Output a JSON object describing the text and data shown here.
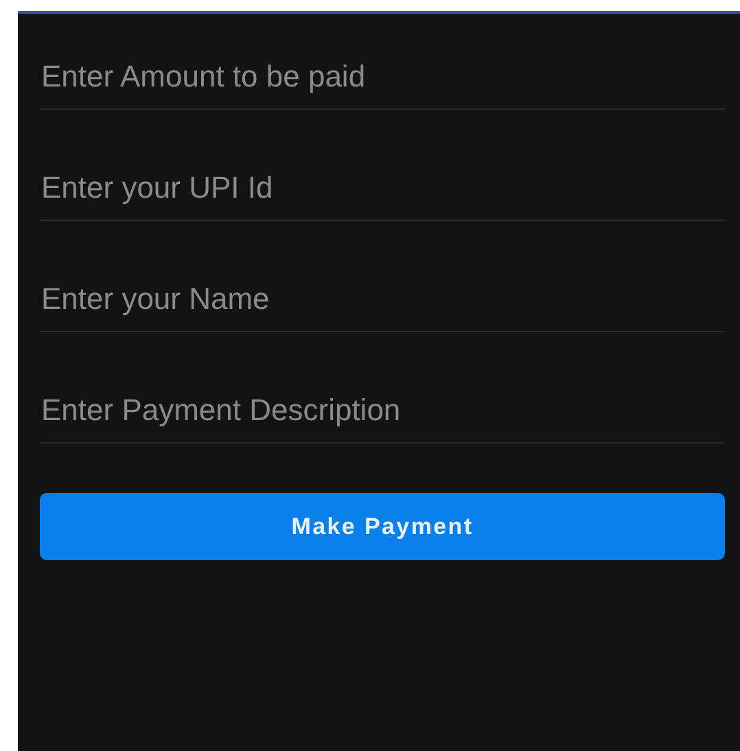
{
  "fields": [
    {
      "placeholder": "Enter Amount to be paid"
    },
    {
      "placeholder": "Enter your UPI Id"
    },
    {
      "placeholder": "Enter your Name"
    },
    {
      "placeholder": "Enter Payment Description"
    }
  ],
  "button": {
    "label": "Make Payment"
  }
}
